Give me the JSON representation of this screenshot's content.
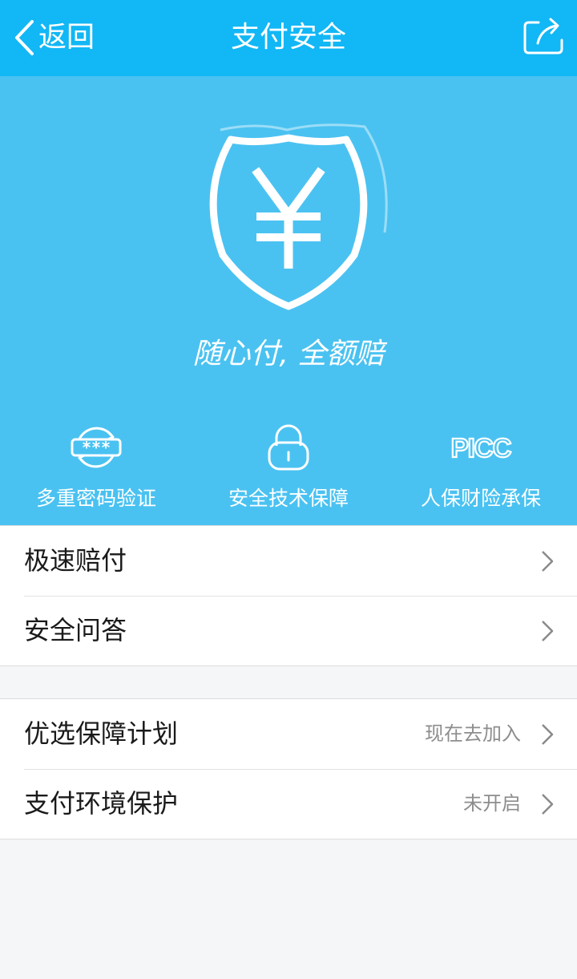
{
  "nav": {
    "back_label": "返回",
    "title": "支付安全",
    "back_icon": "chevron-left-icon",
    "share_icon": "share-icon"
  },
  "hero": {
    "slogan": "随心付, 全额赔",
    "shield_icon": "yen-shield-icon",
    "features": [
      {
        "label": "多重密码验证",
        "icon": "password-refresh-icon"
      },
      {
        "label": "安全技术保障",
        "icon": "lock-icon"
      },
      {
        "label": "人保财险承保",
        "icon": "picc-logo",
        "logo_text": "PICC"
      }
    ]
  },
  "groups": [
    {
      "items": [
        {
          "label": "极速赔付",
          "value": ""
        },
        {
          "label": "安全问答",
          "value": ""
        }
      ]
    },
    {
      "items": [
        {
          "label": "优选保障计划",
          "value": "现在去加入"
        },
        {
          "label": "支付环境保护",
          "value": "未开启"
        }
      ]
    }
  ],
  "colors": {
    "navbar": "#12b7f5",
    "hero": "#4ac2f1",
    "page_background": "#f5f6f8",
    "secondary_text": "#8d8d8d"
  }
}
